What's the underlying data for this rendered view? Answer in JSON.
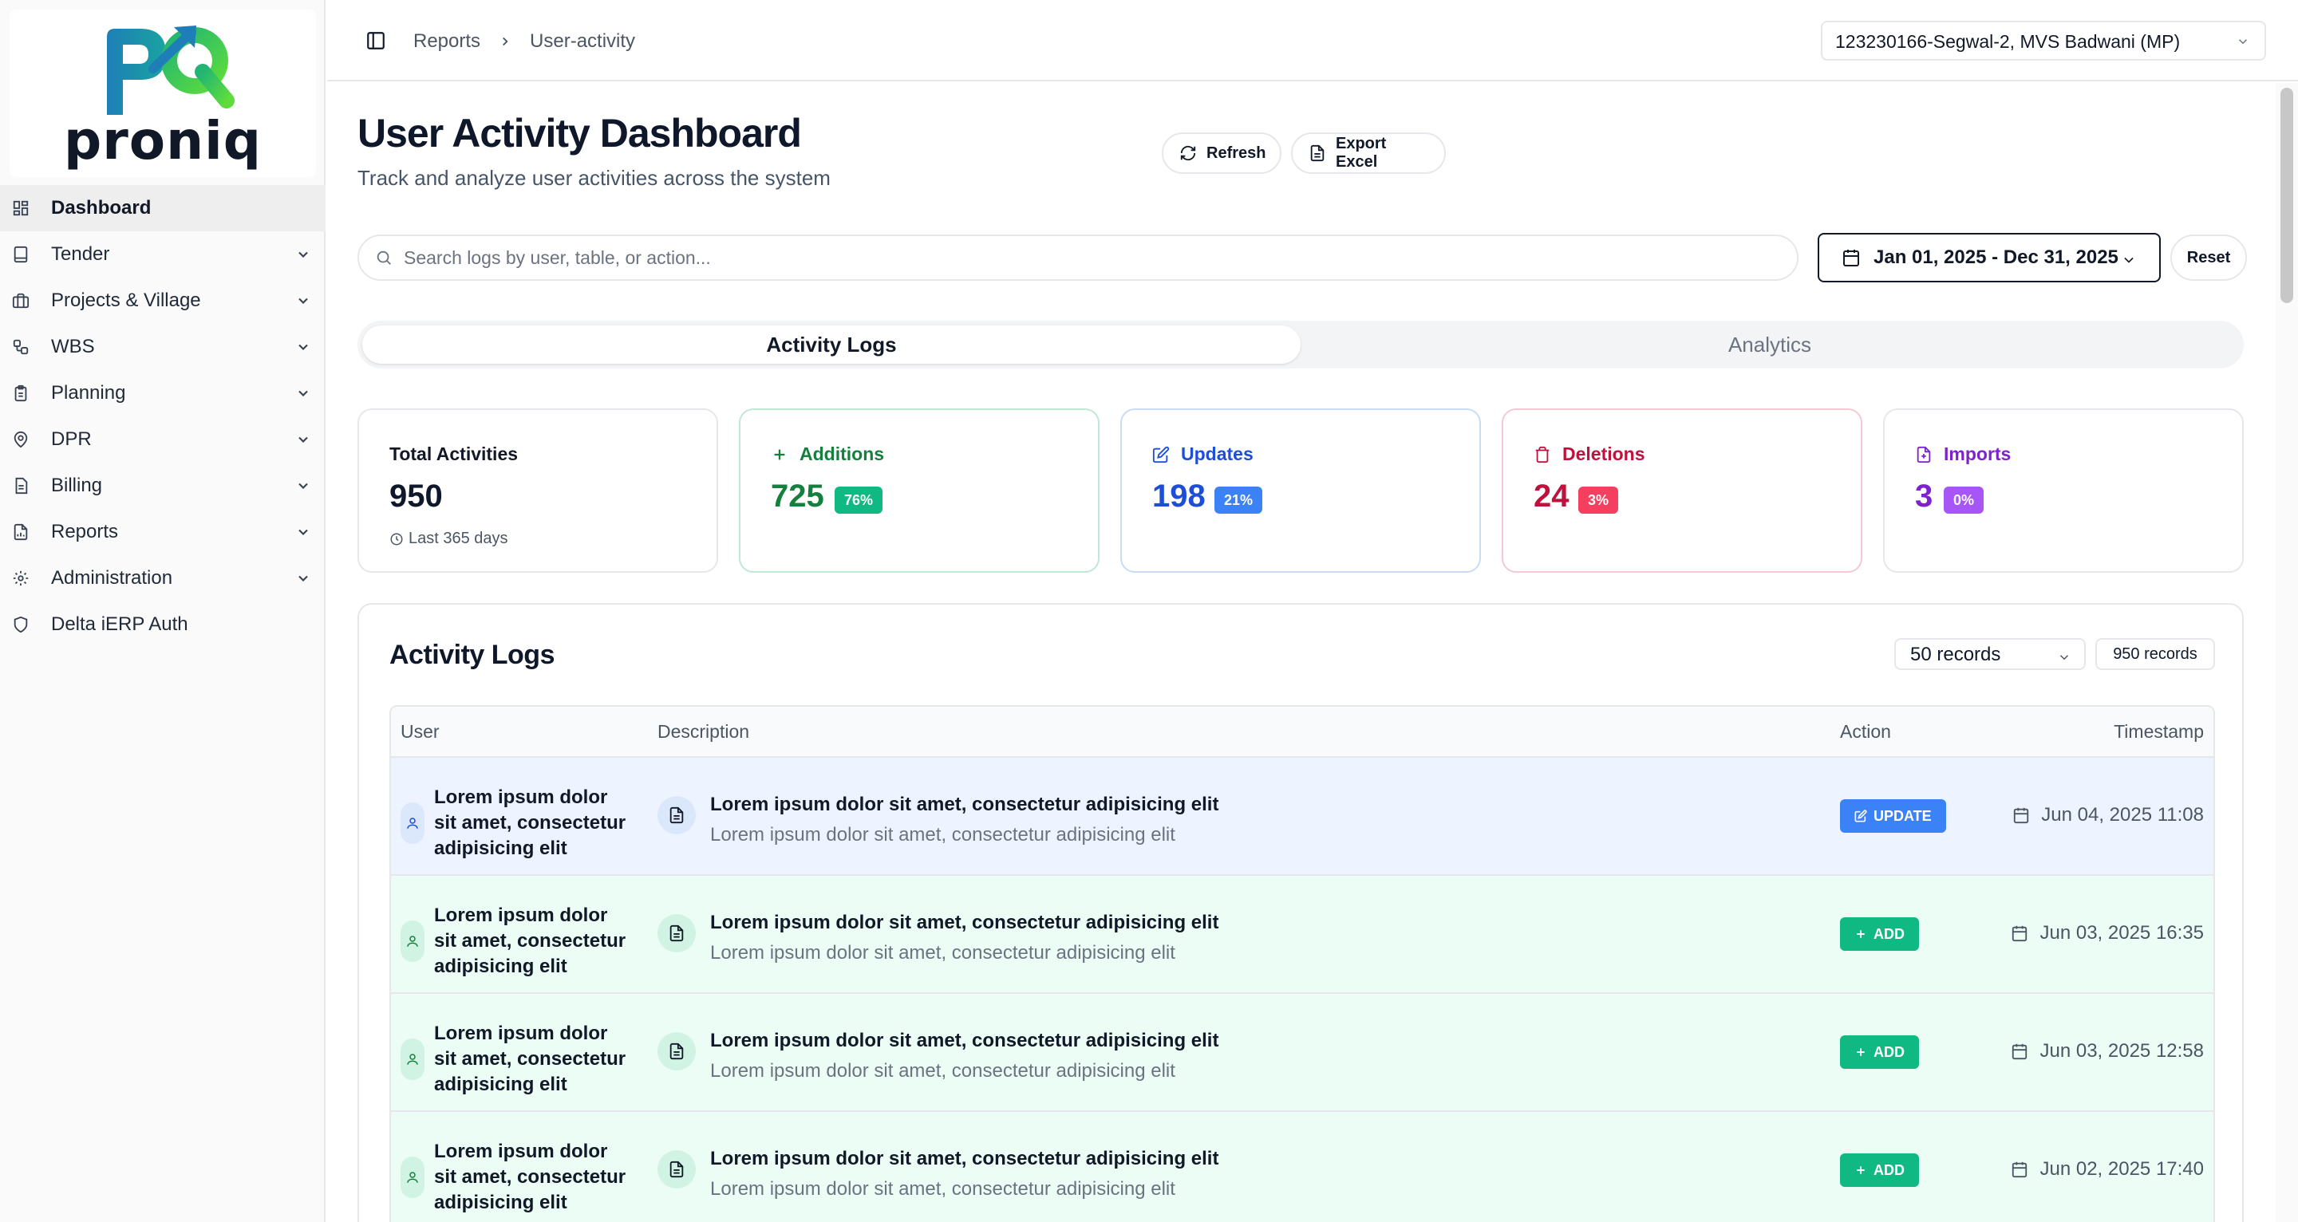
{
  "brand": {
    "name": "proniq"
  },
  "sidebar": {
    "items": [
      {
        "label": "Dashboard",
        "icon": "dashboard-icon",
        "active": true,
        "expandable": false
      },
      {
        "label": "Tender",
        "icon": "tablet-icon",
        "expandable": true
      },
      {
        "label": "Projects & Village",
        "icon": "briefcase-icon",
        "expandable": true
      },
      {
        "label": "WBS",
        "icon": "workflow-icon",
        "expandable": true
      },
      {
        "label": "Planning",
        "icon": "clipboard-icon",
        "expandable": true
      },
      {
        "label": "DPR",
        "icon": "map-pin-icon",
        "expandable": true
      },
      {
        "label": "Billing",
        "icon": "receipt-icon",
        "expandable": true
      },
      {
        "label": "Reports",
        "icon": "report-icon",
        "expandable": true
      },
      {
        "label": "Administration",
        "icon": "gear-icon",
        "expandable": true
      },
      {
        "label": "Delta iERP Auth",
        "icon": "shield-icon",
        "expandable": false
      }
    ]
  },
  "topbar": {
    "breadcrumb": [
      "Reports",
      "User-activity"
    ],
    "site_select": "123230166-Segwal-2, MVS Badwani (MP)"
  },
  "header": {
    "title": "User Activity Dashboard",
    "subtitle": "Track and analyze user activities across the system",
    "refresh_label": "Refresh",
    "export_label": "Export Excel"
  },
  "filters": {
    "search_placeholder": "Search logs by user, table, or action...",
    "date_range": "Jan 01, 2025 - Dec 31, 2025",
    "reset_label": "Reset"
  },
  "tabs": [
    {
      "label": "Activity Logs",
      "active": true
    },
    {
      "label": "Analytics",
      "active": false
    }
  ],
  "stats": {
    "total": {
      "label": "Total Activities",
      "value": "950",
      "note": "Last 365 days"
    },
    "additions": {
      "label": "Additions",
      "value": "725",
      "pct": "76%",
      "color": "#15803d",
      "badge": "#10b981"
    },
    "updates": {
      "label": "Updates",
      "value": "198",
      "pct": "21%",
      "color": "#1d4ed8",
      "badge": "#3b82f6"
    },
    "deletions": {
      "label": "Deletions",
      "value": "24",
      "pct": "3%",
      "color": "#be123c",
      "badge": "#f43f5e"
    },
    "imports": {
      "label": "Imports",
      "value": "3",
      "pct": "0%",
      "color": "#7e22ce",
      "badge": "#a855f7"
    }
  },
  "logs": {
    "title": "Activity Logs",
    "records_select": "50 records",
    "records_count": "950 records",
    "columns": {
      "user": "User",
      "description": "Description",
      "action": "Action",
      "timestamp": "Timestamp"
    },
    "rows": [
      {
        "user": "Lorem ipsum dolor sit amet, consectetur adipisicing elit",
        "title": "Lorem ipsum dolor sit amet, consectetur adipisicing elit",
        "subtitle": "Lorem ipsum dolor sit amet, consectetur adipisicing elit",
        "action": "UPDATE",
        "timestamp": "Jun 04, 2025 11:08"
      },
      {
        "user": "Lorem ipsum dolor sit amet, consectetur adipisicing elit",
        "title": "Lorem ipsum dolor sit amet, consectetur adipisicing elit",
        "subtitle": "Lorem ipsum dolor sit amet, consectetur adipisicing elit",
        "action": "ADD",
        "timestamp": "Jun 03, 2025 16:35"
      },
      {
        "user": "Lorem ipsum dolor sit amet, consectetur adipisicing elit",
        "title": "Lorem ipsum dolor sit amet, consectetur adipisicing elit",
        "subtitle": "Lorem ipsum dolor sit amet, consectetur adipisicing elit",
        "action": "ADD",
        "timestamp": "Jun 03, 2025 12:58"
      },
      {
        "user": "Lorem ipsum dolor sit amet, consectetur adipisicing elit",
        "title": "Lorem ipsum dolor sit amet, consectetur adipisicing elit",
        "subtitle": "Lorem ipsum dolor sit amet, consectetur adipisicing elit",
        "action": "ADD",
        "timestamp": "Jun 02, 2025 17:40"
      }
    ]
  },
  "colors": {
    "update_row_bg": "#eef4ff",
    "add_row_bg": "#ecfdf5",
    "update_badge": "#3b82f6",
    "add_badge": "#10b981"
  }
}
